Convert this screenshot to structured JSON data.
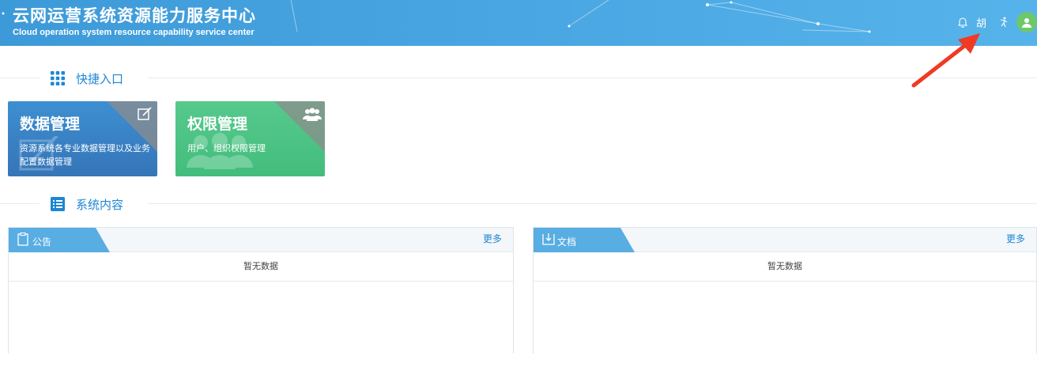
{
  "header": {
    "title_cn": "云网运营系统资源能力服务中心",
    "title_en": "Cloud operation system resource capability service center",
    "user_name": "胡",
    "icons": [
      "bell-icon",
      "user-name",
      "exit-icon",
      "avatar-icon"
    ]
  },
  "quick_entry": {
    "label": "快捷入口",
    "cards": [
      {
        "title": "数据管理",
        "desc": "资源系统各专业数据管理以及业务配置数据管理",
        "icon": "edit-icon",
        "color": "#3b82c4"
      },
      {
        "title": "权限管理",
        "desc": "用户、组织权限管理",
        "icon": "users-icon",
        "color": "#4ec586"
      }
    ]
  },
  "system_content": {
    "label": "系统内容",
    "panels": [
      {
        "title": "公告",
        "more": "更多",
        "empty": "暂无数据",
        "icon": "clipboard-icon"
      },
      {
        "title": "文档",
        "more": "更多",
        "empty": "暂无数据",
        "icon": "download-doc-icon"
      }
    ]
  },
  "colors": {
    "header_bg": "#4aa6e2",
    "accent": "#1c87d4",
    "tab_blue": "#58ade2",
    "card_blue": "#3b82c4",
    "card_green": "#4ec586",
    "annotation_arrow": "#f03a24"
  }
}
